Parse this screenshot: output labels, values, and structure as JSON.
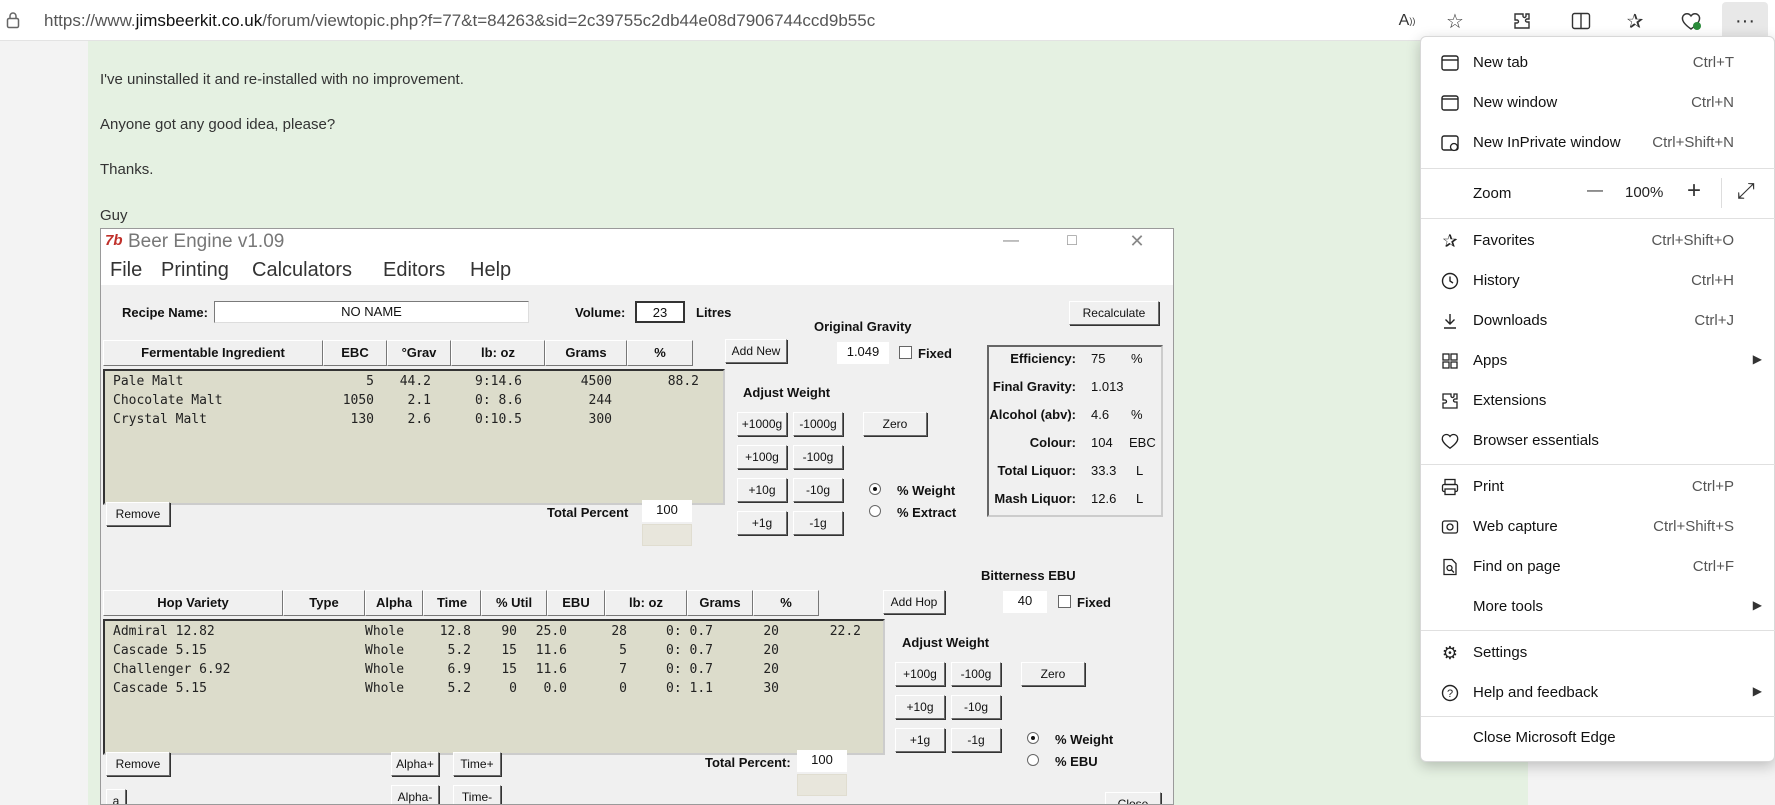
{
  "browser": {
    "url_prefix": "https://www.",
    "url_domain": "jimsbeerkit.co.uk",
    "url_rest": "/forum/viewtopic.php?f=77&t=84263&sid=2c39755c2db44e08d7906744ccd9b55c",
    "toolbar_icons": [
      "read-aloud-icon",
      "favorite-star-icon",
      "extensions-icon",
      "split-screen-icon",
      "favorites-icon",
      "browser-essentials-icon",
      "more-icon"
    ]
  },
  "post": {
    "lines": [
      "I've uninstalled it and re-installed with no improvement.",
      "Anyone got any good idea, please?",
      "Thanks.",
      "Guy"
    ]
  },
  "beer_engine": {
    "title": "Beer Engine v1.09",
    "icon_text": "7b",
    "window_controls": [
      "—",
      "□",
      "✕"
    ],
    "menu": [
      "File",
      "Printing",
      "Calculators",
      "Editors",
      "Help"
    ],
    "recipe_name_label": "Recipe Name:",
    "recipe_name": "NO NAME",
    "volume_label": "Volume:",
    "volume": "23",
    "volume_unit": "Litres",
    "recalculate": "Recalculate",
    "og_label": "Original Gravity",
    "og_value": "1.049",
    "fixed_label": "Fixed",
    "fermentables": {
      "headers": [
        "Fermentable Ingredient",
        "EBC",
        "°Grav",
        "lb: oz",
        "Grams",
        "%"
      ],
      "rows": [
        {
          "name": "Pale Malt",
          "ebc": "5",
          "grav": "44.2",
          "lboz": "9:14.6",
          "grams": "4500",
          "pct": "88.2"
        },
        {
          "name": "Chocolate Malt",
          "ebc": "1050",
          "grav": "2.1",
          "lboz": "0: 8.6",
          "grams": "244",
          "pct": ""
        },
        {
          "name": "Crystal Malt",
          "ebc": "130",
          "grav": "2.6",
          "lboz": "0:10.5",
          "grams": "300",
          "pct": ""
        }
      ],
      "add_new": "Add New",
      "remove": "Remove",
      "total_percent_label": "Total Percent",
      "total_percent": "100",
      "adjust_weight": "Adjust Weight",
      "adjust_buttons": [
        "+1000g",
        "-1000g",
        "+100g",
        "-100g",
        "+10g",
        "-10g",
        "+1g",
        "-1g"
      ],
      "zero": "Zero",
      "radio_weight": "% Weight",
      "radio_extract": "% Extract"
    },
    "stats": [
      {
        "label": "Efficiency:",
        "value": "75",
        "unit": "%"
      },
      {
        "label": "Final Gravity:",
        "value": "1.013",
        "unit": ""
      },
      {
        "label": "Alcohol (abv):",
        "value": "4.6",
        "unit": "%"
      },
      {
        "label": "Colour:",
        "value": "104",
        "unit": "EBC"
      },
      {
        "label": "Total Liquor:",
        "value": "33.3",
        "unit": "L"
      },
      {
        "label": "Mash Liquor:",
        "value": "12.6",
        "unit": "L"
      }
    ],
    "bitterness_label": "Bitterness EBU",
    "bitterness_value": "40",
    "hops": {
      "headers": [
        "Hop Variety",
        "Type",
        "Alpha",
        "Time",
        "% Util",
        "EBU",
        "lb: oz",
        "Grams",
        "%"
      ],
      "rows": [
        {
          "name": "Admiral 12.82",
          "type": "Whole",
          "alpha": "12.8",
          "time": "90",
          "util": "25.0",
          "ebu": "28",
          "lboz": "0: 0.7",
          "grams": "20",
          "pct": "22.2"
        },
        {
          "name": "Cascade 5.15",
          "type": "Whole",
          "alpha": "5.2",
          "time": "15",
          "util": "11.6",
          "ebu": "5",
          "lboz": "0: 0.7",
          "grams": "20",
          "pct": ""
        },
        {
          "name": "Challenger 6.92",
          "type": "Whole",
          "alpha": "6.9",
          "time": "15",
          "util": "11.6",
          "ebu": "7",
          "lboz": "0: 0.7",
          "grams": "20",
          "pct": ""
        },
        {
          "name": "Cascade 5.15",
          "type": "Whole",
          "alpha": "5.2",
          "time": "0",
          "util": "0.0",
          "ebu": "0",
          "lboz": "0: 1.1",
          "grams": "30",
          "pct": ""
        }
      ],
      "add_hop": "Add Hop",
      "remove": "Remove",
      "alpha_plus": "Alpha+",
      "alpha_minus": "Alpha-",
      "time_plus": "Time+",
      "time_minus": "Time-",
      "total_percent_label": "Total Percent:",
      "total_percent": "100",
      "adjust_weight": "Adjust Weight",
      "adjust_buttons": [
        "+100g",
        "-100g",
        "+10g",
        "-10g",
        "+1g",
        "-1g"
      ],
      "zero": "Zero",
      "radio_weight": "% Weight",
      "radio_ebu": "% EBU",
      "close": "Close",
      "corner_text": "a"
    }
  },
  "edge_menu": {
    "items": [
      {
        "icon": "new-tab-icon",
        "label": "New tab",
        "key": "Ctrl+T"
      },
      {
        "icon": "new-window-icon",
        "label": "New window",
        "key": "Ctrl+N"
      },
      {
        "icon": "inprivate-icon",
        "label": "New InPrivate window",
        "key": "Ctrl+Shift+N"
      },
      {
        "icon": "",
        "label": "Zoom",
        "key": ""
      },
      {
        "icon": "favorites-icon",
        "label": "Favorites",
        "key": "Ctrl+Shift+O"
      },
      {
        "icon": "history-icon",
        "label": "History",
        "key": "Ctrl+H"
      },
      {
        "icon": "download-icon",
        "label": "Downloads",
        "key": "Ctrl+J"
      },
      {
        "icon": "apps-icon",
        "label": "Apps",
        "key": ""
      },
      {
        "icon": "extensions-icon",
        "label": "Extensions",
        "key": ""
      },
      {
        "icon": "browser-essentials-icon",
        "label": "Browser essentials",
        "key": ""
      },
      {
        "icon": "print-icon",
        "label": "Print",
        "key": "Ctrl+P"
      },
      {
        "icon": "web-capture-icon",
        "label": "Web capture",
        "key": "Ctrl+Shift+S"
      },
      {
        "icon": "find-icon",
        "label": "Find on page",
        "key": "Ctrl+F"
      },
      {
        "icon": "",
        "label": "More tools",
        "key": ""
      },
      {
        "icon": "settings-icon",
        "label": "Settings",
        "key": ""
      },
      {
        "icon": "help-icon",
        "label": "Help and feedback",
        "key": ""
      },
      {
        "icon": "",
        "label": "Close Microsoft Edge",
        "key": ""
      }
    ],
    "zoom_value": "100%",
    "zoom_minus": "—",
    "zoom_plus": "+",
    "zoom_fullscreen": "⤢"
  }
}
